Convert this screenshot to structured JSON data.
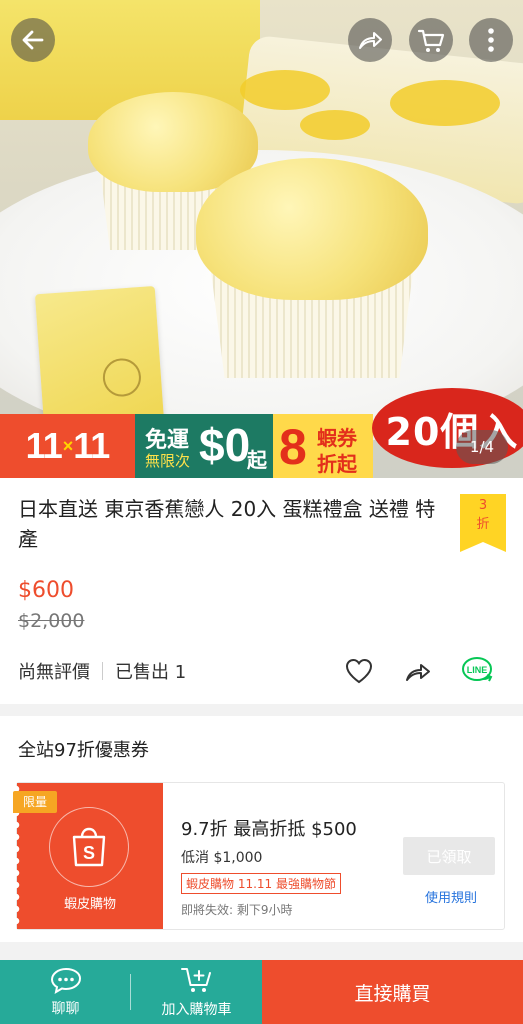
{
  "header": {
    "back_icon": "arrow-left-icon",
    "share_icon": "share-icon",
    "cart_icon": "cart-icon",
    "more_icon": "more-vertical-icon"
  },
  "hero": {
    "promo": {
      "event": "11",
      "event2": "11",
      "x": "×",
      "free_shipping": "免運",
      "unlimited": "無限次",
      "amount": "$0",
      "qi": "起",
      "coupon_big": "8",
      "coupon_t1": "蝦券",
      "coupon_t2": "折起",
      "count": "20個入"
    },
    "pager": "1/4"
  },
  "product": {
    "title": "日本直送 東京香蕉戀人 20入 蛋糕禮盒 送禮 特產",
    "discount_num": "3",
    "discount_unit": "折",
    "price": "$600",
    "original_price": "$2,000",
    "rating": "尚無評價",
    "sold": "已售出 1"
  },
  "voucher_section": {
    "title": "全站97折優惠券",
    "badge": "限量",
    "brand_label": "蝦皮購物",
    "headline": "9.7折 最高折抵 $500",
    "min_spend": "低消 $1,000",
    "tag": "蝦皮購物 11.11 最強購物節",
    "expiry": "即將失效: 剩下9小時",
    "claimed": "已領取",
    "rules": "使用規則"
  },
  "bottom_bar": {
    "chat": "聊聊",
    "add_to_cart": "加入購物車",
    "buy_now": "直接購買"
  },
  "colors": {
    "brand": "#ee4d2d",
    "teal": "#26aa99",
    "line_green": "#06c755",
    "link": "#2673dd"
  }
}
